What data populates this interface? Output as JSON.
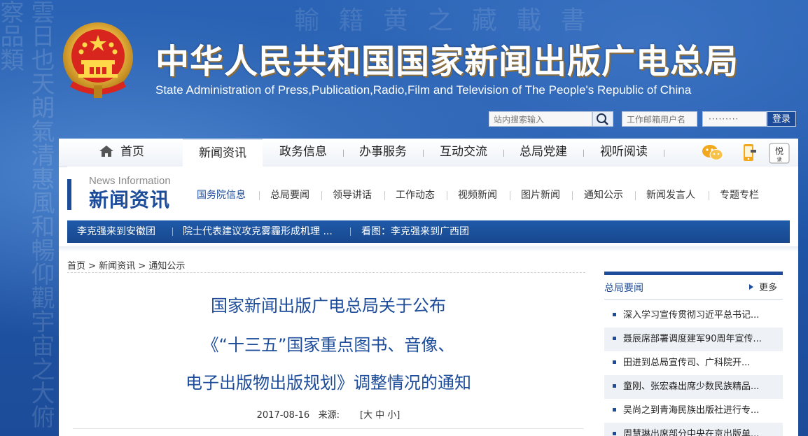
{
  "header": {
    "title": "中华人民共和国国家新闻出版广电总局",
    "subtitle": "State Administration of Press,Publication,Radio,Film and Television of The People's Republic of China"
  },
  "search": {
    "placeholder": "站内搜索输入"
  },
  "mail": {
    "user_placeholder": "工作邮箱用户名",
    "password_mask": "·········",
    "login_label": "登录"
  },
  "nav": {
    "items": [
      "首页",
      "新闻资讯",
      "政务信息",
      "办事服务",
      "互动交流",
      "总局党建",
      "视听阅读"
    ],
    "active": "新闻资讯"
  },
  "section": {
    "title_en": "News Information",
    "title_zh": "新闻资讯",
    "subnav": [
      "国务院信息",
      "总局要闻",
      "领导讲话",
      "工作动态",
      "视频新闻",
      "图片新闻",
      "通知公示",
      "新闻发言人",
      "专题专栏"
    ],
    "ticker": [
      "李克强来到安徽团",
      "院士代表建议攻克雾霾形成机理 ...",
      "看图：李克强来到广西团"
    ]
  },
  "breadcrumb": {
    "home": "首页",
    "sep": ">",
    "level1": "新闻资讯",
    "level2": "通知公示"
  },
  "article": {
    "title_line1": "国家新闻出版广电总局关于公布",
    "title_line2": "《“十三五”国家重点图书、音像、",
    "title_line3": "电子出版物出版规划》调整情况的通知",
    "date": "2017-08-16",
    "source_label": "来源:",
    "font_sizes": "[大 中 小]"
  },
  "sidebar": {
    "title": "总局要闻",
    "more_label": "更多",
    "items": [
      "深入学习宣传贯彻习近平总书记...",
      "聂辰席部署调度建军90周年宣传...",
      "田进到总局宣传司、广科院开...",
      "童刚、张宏森出席少数民族精品...",
      "吴尚之到青海民族出版社进行专...",
      "周慧琳出席部分中央在京出版单..."
    ]
  },
  "colors": {
    "brand_blue": "#1d4c9a",
    "title_shadow": "#8a6d3b"
  }
}
